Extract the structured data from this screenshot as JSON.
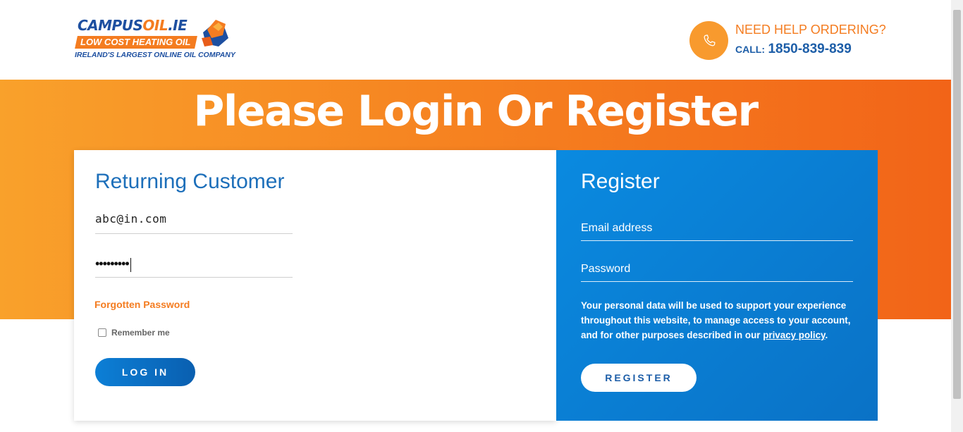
{
  "header": {
    "logo": {
      "brand_main": "CAMPUS",
      "brand_accent": "OIL",
      "brand_suffix": ".IE",
      "tagline": "LOW COST HEATING OIL",
      "subtitle": "IRELAND'S LARGEST ONLINE OIL COMPANY"
    },
    "help": {
      "icon": "phone-icon",
      "title": "NEED HELP ORDERING?",
      "call_label": "CALL:",
      "phone": "1850-839-839"
    }
  },
  "banner": {
    "title": "Please Login Or Register"
  },
  "login": {
    "title": "Returning Customer",
    "email_value": "abc@in.com",
    "password_masked": "•••••••••",
    "forgot_label": "Forgotten Password",
    "remember_label": "Remember me",
    "remember_checked": false,
    "button_label": "LOG IN"
  },
  "register": {
    "title": "Register",
    "email_placeholder": "Email address",
    "password_placeholder": "Password",
    "note_text": "Your personal data will be used to support your experience throughout this website, to manage access to your account, and for other purposes described in our ",
    "privacy_link": "privacy policy",
    "note_end": ".",
    "button_label": "REGISTER"
  },
  "colors": {
    "brand_orange": "#f47c20",
    "brand_blue": "#1d6fba",
    "register_blue": "#0a7fd6"
  }
}
